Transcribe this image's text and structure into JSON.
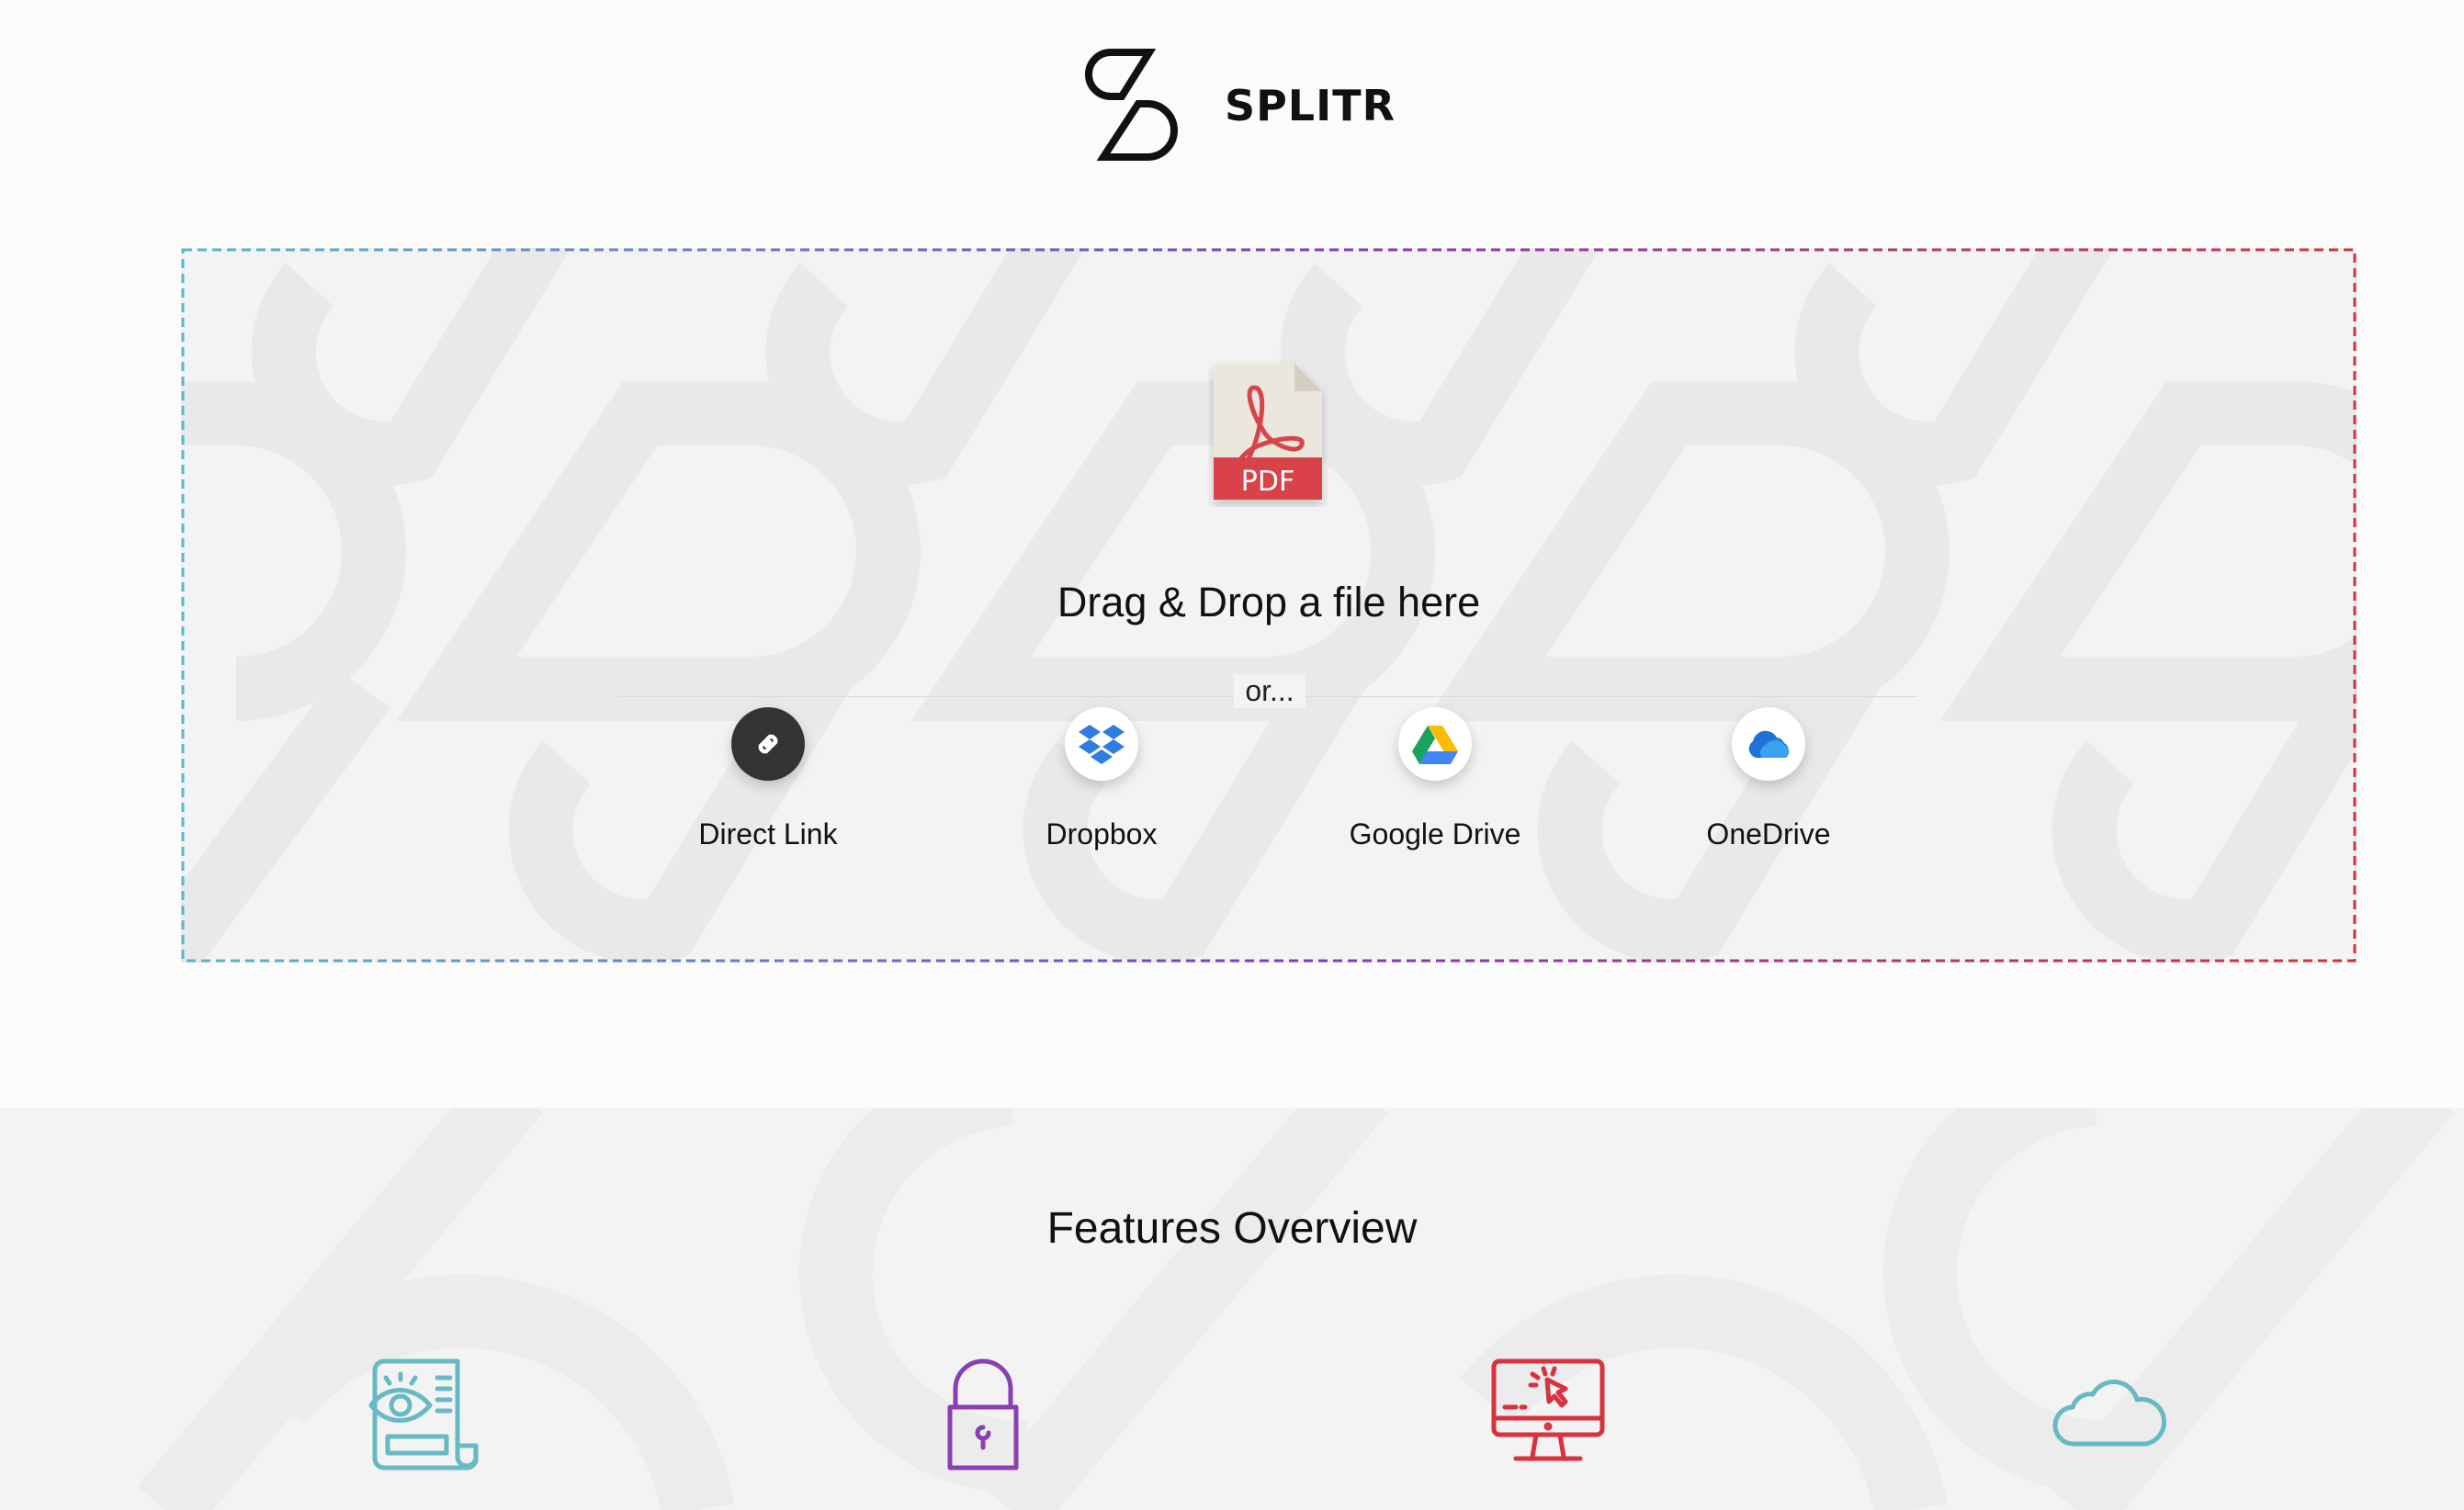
{
  "brand": {
    "name": "SPLITR"
  },
  "dropzone": {
    "file_icon": "pdf-file-icon",
    "file_icon_label": "PDF",
    "drag_text": "Drag & Drop a file here",
    "or_text": "or...",
    "sources": [
      {
        "label": "Direct Link",
        "icon": "link-icon"
      },
      {
        "label": "Dropbox",
        "icon": "dropbox-icon"
      },
      {
        "label": "Google Drive",
        "icon": "google-drive-icon"
      },
      {
        "label": "OneDrive",
        "icon": "onedrive-icon"
      }
    ],
    "border_gradient": [
      "#5bb8c8",
      "#7c3fc0",
      "#d6323c"
    ]
  },
  "features": {
    "title": "Features Overview",
    "icons": [
      "document-eye-icon",
      "padlock-icon",
      "monitor-cursor-icon",
      "cloud-icon"
    ],
    "icon_colors": [
      "#67b9c6",
      "#8a3fb5",
      "#d8323e",
      "#67b9c6"
    ]
  }
}
